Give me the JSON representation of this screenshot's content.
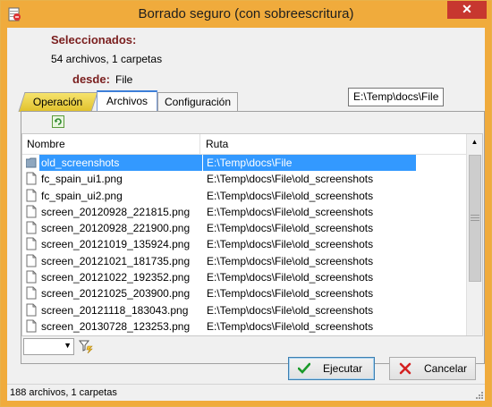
{
  "window": {
    "title": "Borrado seguro (con sobreescritura)",
    "close_glyph": "✕"
  },
  "selection": {
    "label": "Seleccionados:",
    "summary": "54 archivos, 1 carpetas",
    "from_label": "desde:",
    "from_value": "File",
    "path_tooltip": "E:\\Temp\\docs\\File"
  },
  "tabs": [
    {
      "label": "Operación",
      "active": false
    },
    {
      "label": "Archivos",
      "active": true
    },
    {
      "label": "Configuración",
      "active": false
    }
  ],
  "list": {
    "columns": [
      "Nombre",
      "Ruta"
    ],
    "rows": [
      {
        "name": "old_screenshots",
        "path": "E:\\Temp\\docs\\File",
        "type": "folder",
        "selected": true
      },
      {
        "name": "fc_spain_ui1.png",
        "path": "E:\\Temp\\docs\\File\\old_screenshots",
        "type": "file"
      },
      {
        "name": "fc_spain_ui2.png",
        "path": "E:\\Temp\\docs\\File\\old_screenshots",
        "type": "file"
      },
      {
        "name": "screen_20120928_221815.png",
        "path": "E:\\Temp\\docs\\File\\old_screenshots",
        "type": "file"
      },
      {
        "name": "screen_20120928_221900.png",
        "path": "E:\\Temp\\docs\\File\\old_screenshots",
        "type": "file"
      },
      {
        "name": "screen_20121019_135924.png",
        "path": "E:\\Temp\\docs\\File\\old_screenshots",
        "type": "file"
      },
      {
        "name": "screen_20121021_181735.png",
        "path": "E:\\Temp\\docs\\File\\old_screenshots",
        "type": "file"
      },
      {
        "name": "screen_20121022_192352.png",
        "path": "E:\\Temp\\docs\\File\\old_screenshots",
        "type": "file"
      },
      {
        "name": "screen_20121025_203900.png",
        "path": "E:\\Temp\\docs\\File\\old_screenshots",
        "type": "file"
      },
      {
        "name": "screen_20121118_183043.png",
        "path": "E:\\Temp\\docs\\File\\old_screenshots",
        "type": "file"
      },
      {
        "name": "screen_20130728_123253.png",
        "path": "E:\\Temp\\docs\\File\\old_screenshots",
        "type": "file"
      }
    ]
  },
  "toolbar": {
    "refresh_icon": "refresh-icon",
    "filter_icon": "filter-icon"
  },
  "buttons": {
    "execute_label": "Ejecutar",
    "cancel_label": "Cancelar"
  },
  "status": {
    "text": "188 archivos, 1 carpetas"
  },
  "colors": {
    "title_bar": "#f0ab3c",
    "close_button": "#c7372f",
    "label_color": "#7a1e1e",
    "selection": "#3399ff",
    "active_tab": "#e8c93a"
  }
}
